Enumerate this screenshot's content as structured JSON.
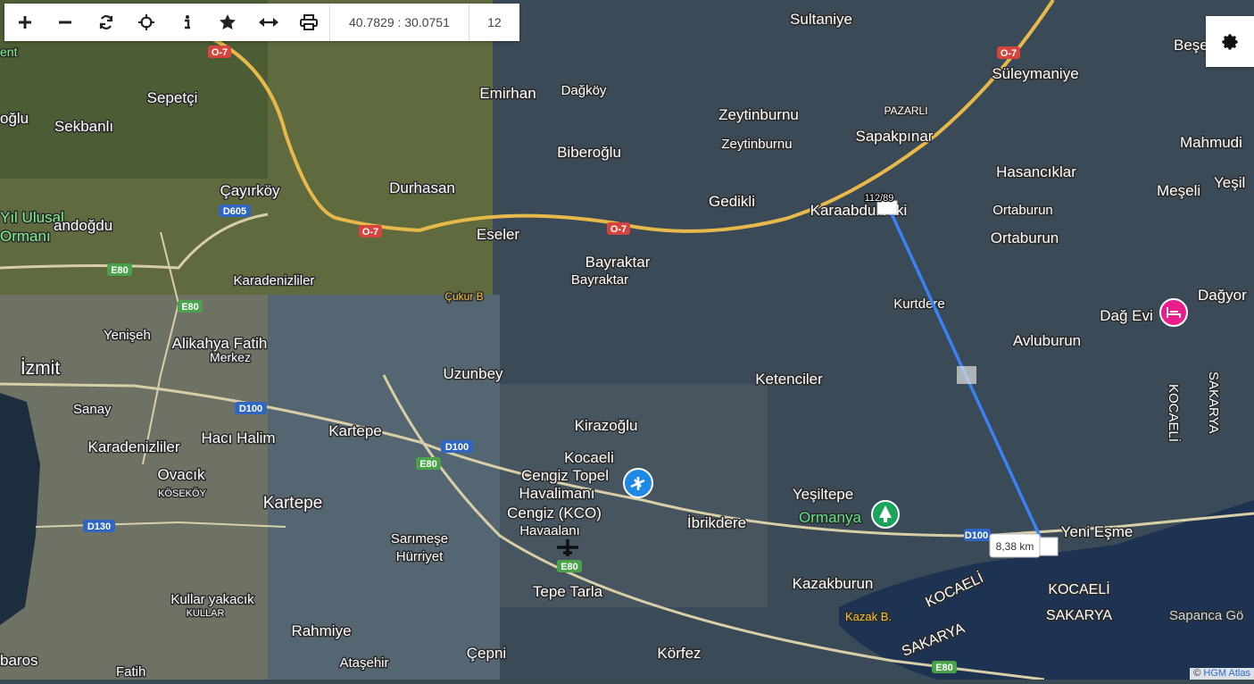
{
  "toolbar": {
    "buttons": [
      {
        "name": "zoom-in-button",
        "icon": "plus-icon"
      },
      {
        "name": "zoom-out-button",
        "icon": "minus-icon"
      },
      {
        "name": "refresh-button",
        "icon": "refresh-icon"
      },
      {
        "name": "locate-button",
        "icon": "crosshair-icon"
      },
      {
        "name": "info-button",
        "icon": "info-icon"
      },
      {
        "name": "favorite-button",
        "icon": "star-icon"
      },
      {
        "name": "measure-button",
        "icon": "arrows-horizontal-icon"
      },
      {
        "name": "print-button",
        "icon": "printer-icon"
      }
    ],
    "coordinates": "40.7829 : 30.0751",
    "zoom_level": "12"
  },
  "settings": {
    "icon": "gear-icon"
  },
  "attribution": {
    "prefix": "©",
    "link": "HGM Atlas"
  },
  "measurement": {
    "distance": "8,38 km",
    "bearing": "112/89"
  },
  "places": {
    "sultaniye": "Sultaniye",
    "beşevler": "Beşevler",
    "süleymaniye": "Süleymaniye",
    "emirhan": "Emirhan",
    "dagkoy": "Dağköy",
    "zeytinburnu1": "Zeytinburnu",
    "zeytinburnu2": "Zeytinburnu",
    "pazarli": "PAZARLI",
    "sapakpinar": "Sapakpınar",
    "mahmudiye": "Mahmudi",
    "sepetci": "Sepetçi",
    "oglu": "oğlu",
    "sekbanli": "Sekbanlı",
    "biberoglu": "Biberoğlu",
    "hasancilar": "Hasancıklar",
    "meseli": "Meşeli",
    "yesil": "Yeşil",
    "cayirkoy": "Çayırköy",
    "durhasan": "Durhasan",
    "gedikli": "Gedikli",
    "karaabdulbaki": "Karaabdulbaki",
    "ortaburun1": "Ortaburun",
    "ortaburun2": "Ortaburun",
    "yilulusal": "Yıl Ulusal",
    "ormani": "Ormanı",
    "andogdu": "andoğdu",
    "eseler": "Eseler",
    "bayraktar1": "Bayraktar",
    "bayraktar2": "Bayraktar",
    "dagyoran": "Dağyor",
    "karadenizliler1": "Karadenizliler",
    "cukurb": "Çukur B",
    "kurtdere": "Kurtdere",
    "dagevi": "Dağ Evi",
    "yenisehir": "Yenişeh",
    "alikahya": "Alikahya Fatih",
    "merkez": "Merkez",
    "avluburun": "Avluburun",
    "izmit": "İzmit",
    "uzunbey": "Uzunbey",
    "ketenciler": "Ketenciler",
    "sanayi": "Sanay",
    "haci": "Hacı Halim",
    "kartepe1": "Kartepe",
    "kirazoglu": "Kirazoğlu",
    "kocaeli_v": "KOCAELİ",
    "sakarya_v": "SAKARYA",
    "karadenizliler2": "Karadenizliler",
    "kocaeli": "Kocaeli",
    "cengiz": "Cengiz Topel",
    "havalimani": "Havalimanı",
    "ovacik": "Ovacık",
    "koseköy": "KÖSEKÖY",
    "kartepe2": "Kartepe",
    "cengizkco": "Cengiz (KCO)",
    "havaalani": "Havaalanı",
    "yesiltepe": "Yeşiltepe",
    "ormanya": "Ormanya",
    "ibrikdere": "İbrikdere",
    "yeniesme": "Yeni Eşme",
    "sarimese": "Sarımeşe",
    "hurriyet": "Hürriyet",
    "kullar": "Kullar yakacık",
    "kullar2": "KULLAR",
    "tepetarla": "Tepe Tarla",
    "kazakburun": "Kazakburun",
    "kocaeli2": "KOCAELİ",
    "kocaeli3": "KOCAELİ",
    "sakarya2": "SAKARYA",
    "sakarya3": "SAKARYA",
    "kazakb": "Kazak B.",
    "sapanca": "Sapanca Gö",
    "rahmiye": "Rahmiye",
    "cepni": "Çepni",
    "korfez": "Körfez",
    "atasehir": "Ataşehir",
    "baros": "baros",
    "fatih": "Fatih",
    "ent": "ent"
  },
  "roads": {
    "o7a": "O-7",
    "o7b": "O-7",
    "o7c": "O-7",
    "o7d": "O-7",
    "d605": "D605",
    "e80a": "E80",
    "e80b": "E80",
    "e80c": "E80",
    "e80d": "E80",
    "e80e": "E80",
    "d100a": "D100",
    "d100b": "D100",
    "d100c": "D100",
    "d130": "D130"
  },
  "colors": {
    "measure_line": "#3b82f6",
    "poi_pink": "#e91e8c",
    "poi_green": "#1aa35a",
    "airport_blue": "#1e88e5",
    "road": "#e7b84a"
  }
}
